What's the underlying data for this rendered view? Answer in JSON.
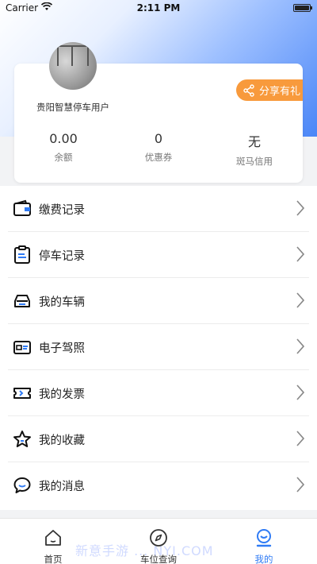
{
  "status_bar": {
    "carrier": "Carrier",
    "time": "2:11 PM"
  },
  "profile": {
    "username": "贵阳智慧停车用户",
    "share_label": "分享有礼",
    "stats": [
      {
        "value": "0.00",
        "label": "余额"
      },
      {
        "value": "0",
        "label": "优惠券"
      },
      {
        "value": "无",
        "label": "斑马信用"
      }
    ]
  },
  "menu": [
    {
      "label": "缴费记录",
      "icon": "wallet-icon"
    },
    {
      "label": "停车记录",
      "icon": "clipboard-icon"
    },
    {
      "label": "我的车辆",
      "icon": "car-icon"
    },
    {
      "label": "电子驾照",
      "icon": "id-card-icon"
    },
    {
      "label": "我的发票",
      "icon": "ticket-icon"
    },
    {
      "label": "我的收藏",
      "icon": "star-icon"
    },
    {
      "label": "我的消息",
      "icon": "message-icon"
    }
  ],
  "tabbar": {
    "tabs": [
      {
        "label": "首页",
        "icon": "home-icon"
      },
      {
        "label": "车位查询",
        "icon": "compass-icon"
      },
      {
        "label": "我的",
        "icon": "user-icon"
      }
    ],
    "active_index": 2,
    "active_color": "#2f7bf5"
  },
  "colors": {
    "accent": "#2f7bf5",
    "share": "#f89a3c"
  },
  "watermark": "新意手游 ... NYI.COM"
}
